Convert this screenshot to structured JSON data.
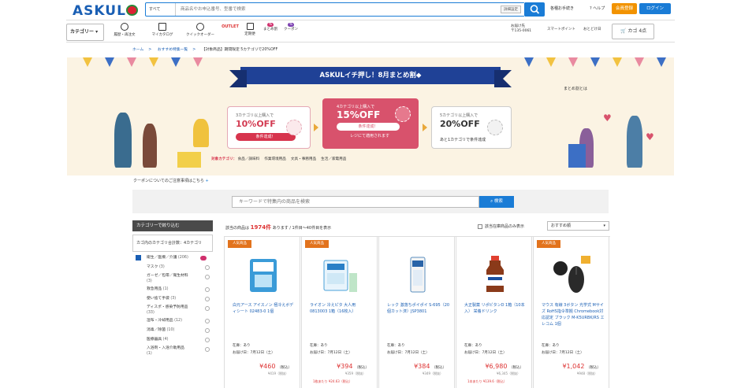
{
  "header": {
    "logo_text": "ASKUL",
    "search": {
      "category": "すべて",
      "placeholder": "商品名やお申込番号、型番で検索",
      "advanced": "詳細設定"
    },
    "links": {
      "order": "各種お手続き",
      "help": "ヘルプ"
    },
    "register_button": "会員登録",
    "login_button": "ログイン"
  },
  "nav": {
    "category_button": "カテゴリー",
    "items": [
      {
        "label": "履歴・再注文",
        "icon": "history-icon"
      },
      {
        "label": "マイカタログ",
        "icon": "book-icon"
      },
      {
        "label": "クイックオーダー",
        "icon": "quick-order-icon"
      },
      {
        "label": "OUTLET",
        "icon": "outlet-icon"
      },
      {
        "label": "定期便",
        "icon": "subscription-icon"
      },
      {
        "label": "まとめ割",
        "icon": "bulk-discount-icon"
      },
      {
        "label": "クーポン",
        "icon": "coupon-icon"
      }
    ],
    "address_line1": "お届け先",
    "address_line2": "〒135-0061",
    "points": "スマートポイント",
    "favorites": "おとどけ日",
    "cart": "カゴ 4点"
  },
  "breadcrumb": [
    "ホーム",
    "おすすめ特集一覧",
    "【対象商品】期間限定 5カテゴリで20%OFF"
  ],
  "banner": {
    "ribbon": "ASKULイチ押し！8月まとめ割◆",
    "matome_link": "まとめ割とは",
    "tiers": [
      {
        "title": "3カテゴリ以上購入で",
        "discount": "10%OFF",
        "button": "条件達成！"
      },
      {
        "title": "4カテゴリ以上購入で",
        "discount": "15%OFF",
        "button": "条件達成！",
        "sub": "レジにて適用されます"
      },
      {
        "title": "5カテゴリ以上購入で",
        "discount": "20%OFF",
        "sub": "あと1カテゴリで条件達成"
      }
    ],
    "categories_label": "対象カテゴリ：",
    "categories": [
      "食品／調味料",
      "作業環境用品",
      "文具・事務用品",
      "生活／家電用品"
    ]
  },
  "coupon_note": "クーポンについてのご注意事項はこちら",
  "keyword_search": {
    "placeholder": "キーワードで特集内の商品を検索",
    "button": "検索"
  },
  "sidebar": {
    "heading": "カテゴリーで絞り込む",
    "current": "カゴ内のカテゴリ合計数：4カテゴリ",
    "items": [
      {
        "label": "衛生／医療／介護",
        "count": "(206)"
      },
      {
        "label": "マスク",
        "count": "(3)"
      },
      {
        "label": "ガーゼ／包帯／衛生材料",
        "count": "(3)"
      },
      {
        "label": "救急用品",
        "count": "(1)"
      },
      {
        "label": "使い捨て手袋",
        "count": "(3)"
      },
      {
        "label": "ディスポ・感染予防用品",
        "count": "(33)"
      },
      {
        "label": "湿布・冷却用品",
        "count": "(12)"
      },
      {
        "label": "消毒／除菌",
        "count": "(10)"
      },
      {
        "label": "医療器具",
        "count": "(4)"
      },
      {
        "label": "入浴剤・入浴介助用品",
        "count": "(1)"
      }
    ]
  },
  "results": {
    "prefix": "該当の商品は",
    "count": "1974件",
    "suffix": "あります / 1件目〜40件目を表示",
    "stock_option": "該当在庫商品のみ表示",
    "sort": "おすすめ順"
  },
  "products": [
    {
      "badge": "人気商品",
      "name": "白元アース アイスノン 極冷えボディシート 02483-0 1個",
      "stock": "在庫：あり",
      "delivery": "お届け日：7月12日（土）",
      "price": "¥460",
      "tax": "（税込）",
      "ref": "¥419（税抜）",
      "note": ""
    },
    {
      "badge": "人気商品",
      "name": "ライオン 冷えピタ 大人用 0813003 1箱（16枚入）",
      "stock": "在庫：あり",
      "delivery": "お届け日：7月12日（土）",
      "price": "¥394",
      "tax": "（税込）",
      "ref": "¥359（税抜）",
      "note": "1枚あたり ¥24.63（税込）"
    },
    {
      "badge": "",
      "name": "レック 激落ちポイポイ S-695（20個カット済）JSP3801",
      "stock": "在庫：あり",
      "delivery": "お届け日：7月12日（土）",
      "price": "¥384",
      "tax": "（税込）",
      "ref": "¥349（税抜）",
      "note": ""
    },
    {
      "badge": "",
      "name": "大正製薬 リポビタンD 1箱（10本入） 栄養ドリンク",
      "stock": "在庫：あり",
      "delivery": "お届け日：7月12日（土）",
      "price": "¥6,980",
      "tax": "（税込）",
      "ref": "¥6,345（税抜）",
      "note": "1本あたり ¥139.6（税込）"
    },
    {
      "badge": "人気商品",
      "name": "マウス 有線 3ボタン 光学式 Mサイズ RoHS指令準拠 Chromebook対応認定 ブラック M-K5URBK/RS エレコム 1個",
      "stock": "在庫：あり",
      "delivery": "お届け日：7月12日（土）",
      "price": "¥1,042",
      "tax": "（税込）",
      "ref": "¥948（税抜）",
      "note": ""
    }
  ],
  "colors": {
    "brand_blue": "#1a7cd6",
    "logo_blue": "#1a5fb4",
    "ribbon_navy": "#1f4196",
    "accent_pink": "#d8526c",
    "price_red": "#dd3333",
    "orange": "#f29300"
  }
}
